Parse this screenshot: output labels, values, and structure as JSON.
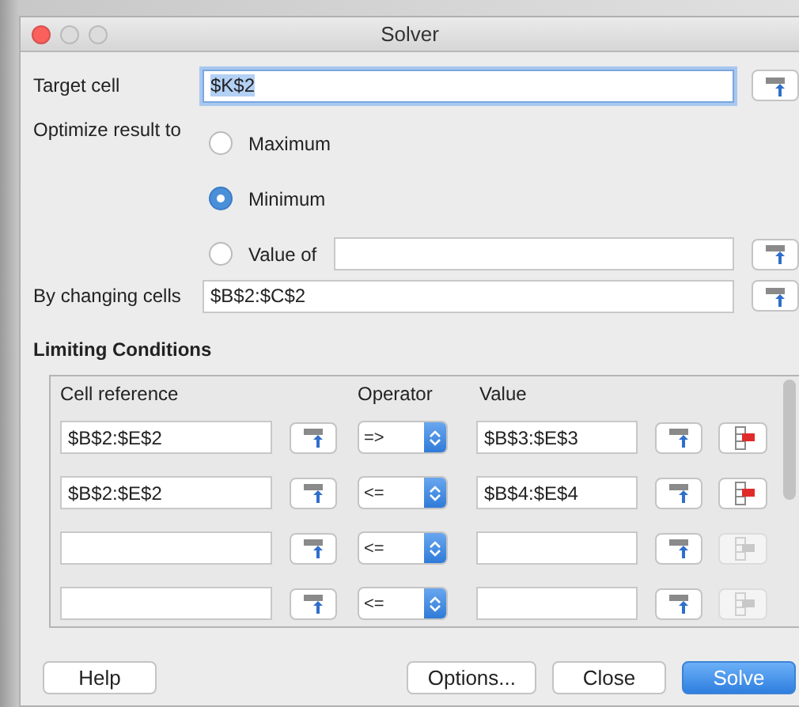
{
  "window": {
    "title": "Solver"
  },
  "target_cell": {
    "label": "Target cell",
    "value": "$K$2"
  },
  "optimize": {
    "label": "Optimize result to",
    "options": [
      {
        "label": "Maximum",
        "selected": false,
        "kind": "plain"
      },
      {
        "label": "Minimum",
        "selected": true,
        "kind": "plain"
      },
      {
        "label": "Value of",
        "selected": false,
        "kind": "field"
      }
    ]
  },
  "changing_cells": {
    "label": "By changing cells",
    "value": "$B$2:$C$2"
  },
  "limiting_conditions": {
    "title": "Limiting Conditions",
    "columns": [
      "Cell reference",
      "Operator",
      "Value"
    ],
    "rows": [
      {
        "cell_reference": "$B$2:$E$2",
        "operator": "=>",
        "value": "$B$3:$E$3",
        "delete_disabled": false
      },
      {
        "cell_reference": "$B$2:$E$2",
        "operator": "<=",
        "value": "$B$4:$E$4",
        "delete_disabled": false
      },
      {
        "cell_reference": "",
        "operator": "<=",
        "value": "",
        "delete_disabled": true
      },
      {
        "cell_reference": "",
        "operator": "<=",
        "value": "",
        "delete_disabled": true
      }
    ]
  },
  "buttons": [
    {
      "label": "Help",
      "kind": "plain"
    },
    {
      "label": "Options...",
      "kind": "plain"
    },
    {
      "label": "Close",
      "kind": "plain"
    },
    {
      "label": "Solve",
      "kind": "default"
    }
  ]
}
